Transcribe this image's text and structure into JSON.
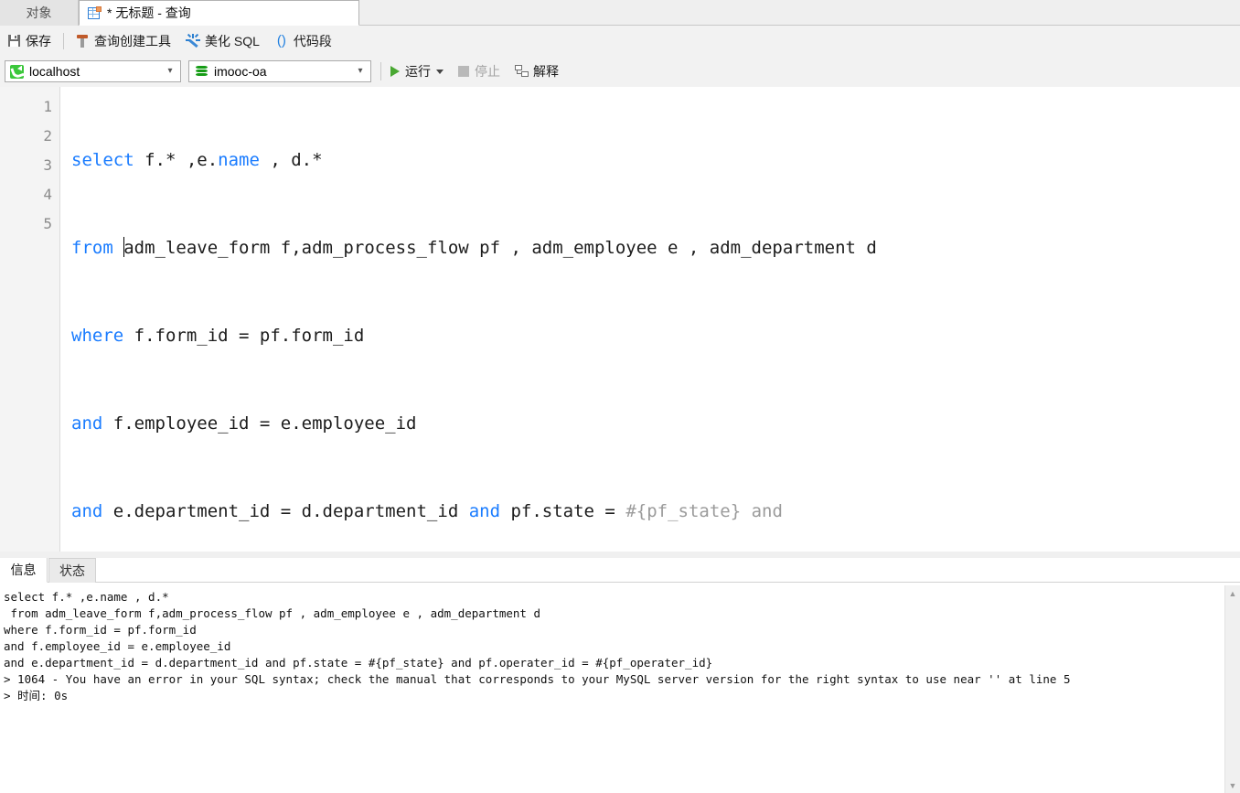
{
  "tabs": {
    "object_tab": "对象",
    "query_tab": "* 无标题 - 查询"
  },
  "toolbar": {
    "save": "保存",
    "query_builder": "查询创建工具",
    "beautify_sql": "美化 SQL",
    "code_snippet": "代码段"
  },
  "connection_bar": {
    "connection": "localhost",
    "database": "imooc-oa",
    "run": "运行",
    "stop": "停止",
    "explain": "解释"
  },
  "editor": {
    "line_numbers": [
      "1",
      "2",
      "3",
      "4",
      "5"
    ],
    "lines": [
      "  select f.* ,e.name , d.*",
      "  from adm_leave_form f,adm_process_flow pf , adm_employee e , adm_department d",
      "where f.form_id = pf.form_id",
      "and f.employee_id = e.employee_id",
      "and e.department_id = d.department_id and pf.state = #{pf_state} and pf.operater_id = #{pf_operater_id}"
    ]
  },
  "bottom_tabs": {
    "info": "信息",
    "status": "状态"
  },
  "output": {
    "lines": [
      "select f.* ,e.name , d.*",
      " from adm_leave_form f,adm_process_flow pf , adm_employee e , adm_department d",
      "where f.form_id = pf.form_id",
      "and f.employee_id = e.employee_id",
      "and e.department_id = d.department_id and pf.state = #{pf_state} and pf.operater_id = #{pf_operater_id}",
      "> 1064 - You have an error in your SQL syntax; check the manual that corresponds to your MySQL server version for the right syntax to use near '' at line 5",
      "> 时间: 0s"
    ]
  },
  "colors": {
    "keyword": "#1a7cff",
    "placeholder": "#9b9b9b",
    "run_green": "#49a832",
    "toolbar_bg": "#f2f2f2"
  },
  "scrollbar": {
    "up": "▲",
    "down": "▼"
  }
}
